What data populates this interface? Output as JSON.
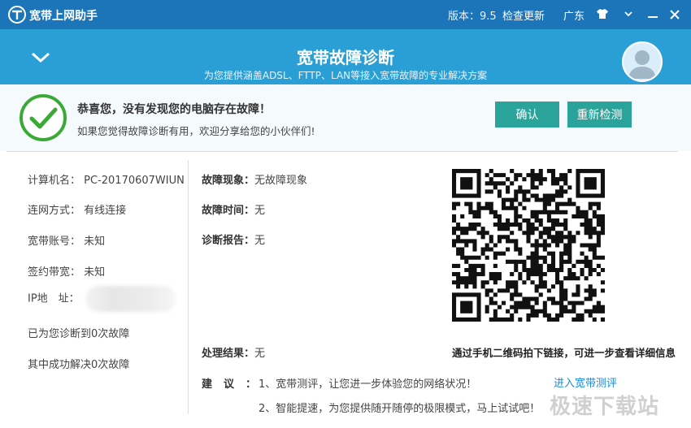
{
  "titlebar": {
    "app_title": "宽带上网助手",
    "version": "版本：9.5",
    "check_update": "检查更新",
    "region": "广东"
  },
  "banner": {
    "title": "宽带故障诊断",
    "subtitle": "为您提供涵盖ADSL、FTTP、LAN等接入宽带故障的专业解决方案"
  },
  "result": {
    "title": "恭喜您，没有发现您的电脑存在故障！",
    "subtitle": "如果您觉得故障诊断有用，欢迎分享给您的小伙伴们!",
    "confirm_label": "确认",
    "retest_label": "重新检测"
  },
  "info": {
    "computer_name_label": "计算机名：",
    "computer_name": "PC-20170607WIUN",
    "connection_label": "连网方式：",
    "connection": "有线连接",
    "account_label": "宽带账号：",
    "account": "未知",
    "bandwidth_label": "签约带宽：",
    "bandwidth": "未知",
    "ip_label": "IP地　址：",
    "diagnosed": "已为您诊断到0次故障",
    "solved": "其中成功解决0次故障"
  },
  "fault": {
    "symptom_label": "故障现象：",
    "symptom": "无故障现象",
    "time_label": "故障时间：",
    "time": "无",
    "report_label": "诊断报告：",
    "report": "无",
    "result_label": "处理结果：",
    "result": "无"
  },
  "suggest": {
    "label": "建议：",
    "item1": "1、宽带测评，让您进一步体验您的网络状况！",
    "item2": "2、智能提速，为您提供随开随停的极限模式，马上试试吧！",
    "link1": "进入宽带测评"
  },
  "qr": {
    "caption": "通过手机二维码拍下链接，可进一步查看详细信息"
  },
  "watermark": "极速下载站",
  "colors": {
    "titlebar": "#1b75b8",
    "banner": "#2a9fd6",
    "button": "#2aa39a",
    "ok_green": "#3aa935",
    "link": "#1a8cd0"
  }
}
